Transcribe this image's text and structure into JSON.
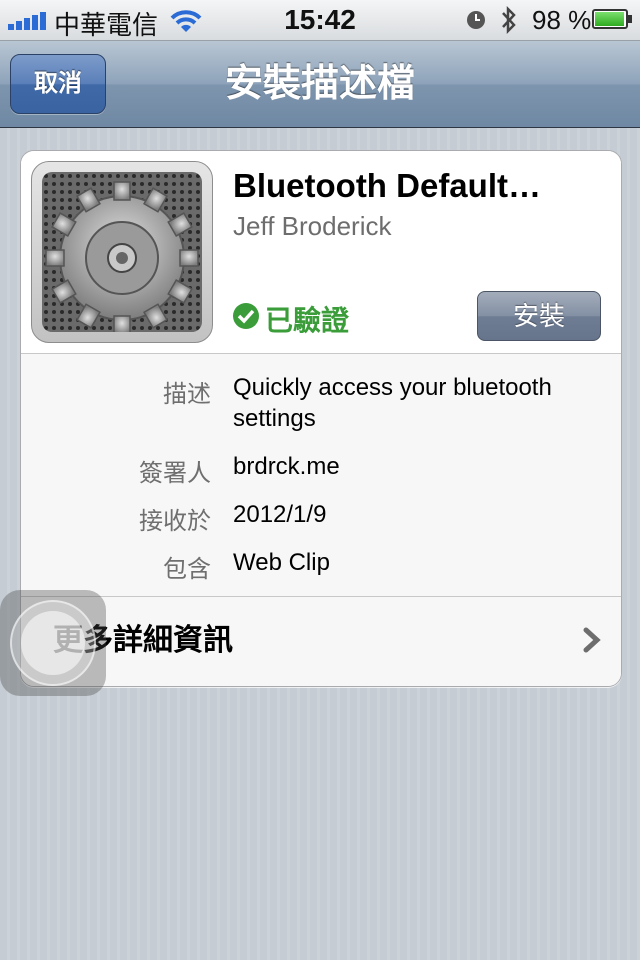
{
  "status_bar": {
    "carrier": "中華電信",
    "time": "15:42",
    "battery_percent": "98 %",
    "battery_level": 0.98
  },
  "nav_bar": {
    "title": "安裝描述檔",
    "cancel_label": "取消"
  },
  "profile": {
    "name": "Bluetooth Default…",
    "author": "Jeff Broderick",
    "verified_label": "已驗證",
    "install_label": "安裝"
  },
  "details": [
    {
      "label": "描述",
      "value": "Quickly access your bluetooth settings"
    },
    {
      "label": "簽署人",
      "value": "brdrck.me"
    },
    {
      "label": "接收於",
      "value": "2012/1/9"
    },
    {
      "label": "包含",
      "value": "Web Clip"
    }
  ],
  "more_info": {
    "label": "更多詳細資訊"
  },
  "colors": {
    "verified_green": "#3a9d3a",
    "nav_blue": "#6f88a3",
    "cancel_blue": "#3f69a7"
  },
  "icons": [
    "signal-bars-icon",
    "wifi-icon",
    "clock-icon",
    "bluetooth-icon",
    "battery-icon",
    "gear-icon",
    "checkmark-icon",
    "chevron-right-icon",
    "assistive-touch-icon"
  ]
}
